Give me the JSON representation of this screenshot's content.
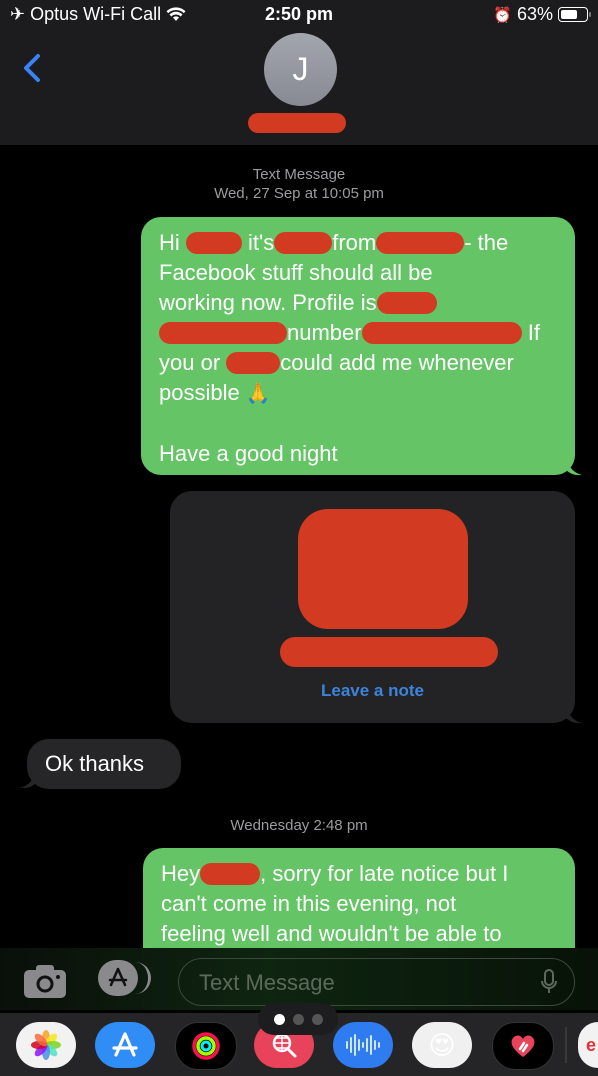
{
  "status_bar": {
    "carrier": "Optus Wi-Fi Call",
    "time": "2:50 pm",
    "battery_percent": "63%",
    "battery_level": 0.63
  },
  "header": {
    "contact_initial": "J",
    "contact_name_redacted": true
  },
  "conversation": {
    "thread1_label": "Text Message",
    "thread1_date": "Wed, 27 Sep at 10:05 pm",
    "msg1": {
      "line1_a": "Hi",
      "line1_b": "it's",
      "line1_c": "from",
      "line1_d": "- the",
      "line2": "Facebook stuff should all be",
      "line3": "working now. Profile is",
      "line4_a": "number",
      "line4_b": "If",
      "line5_a": "you or",
      "line5_b": "could add me whenever",
      "line6": "possible",
      "emoji": "🙏",
      "line7": "Have a good night"
    },
    "contact_card": {
      "action_label": "Leave a note"
    },
    "msg2": "Ok thanks",
    "thread2_date": "Wednesday 2:48 pm",
    "msg3": {
      "line1_a": "Hey",
      "line1_b": ", sorry for late notice but I",
      "line2": "can't come in this evening, not",
      "line3": "feeling well and wouldn't be able to"
    }
  },
  "compose": {
    "placeholder": "Text Message"
  },
  "app_drawer": {
    "page_dots": 3,
    "active_page": 0,
    "apps": [
      "Photos",
      "App Store",
      "Activity",
      "Search Images",
      "Audio Messages",
      "Memoji",
      "Digital Touch",
      "eBay"
    ]
  },
  "colors": {
    "sms_green": "#65c466",
    "incoming_gray": "#262629",
    "link_blue": "#3d84d9",
    "redaction_red": "#d23b22"
  }
}
